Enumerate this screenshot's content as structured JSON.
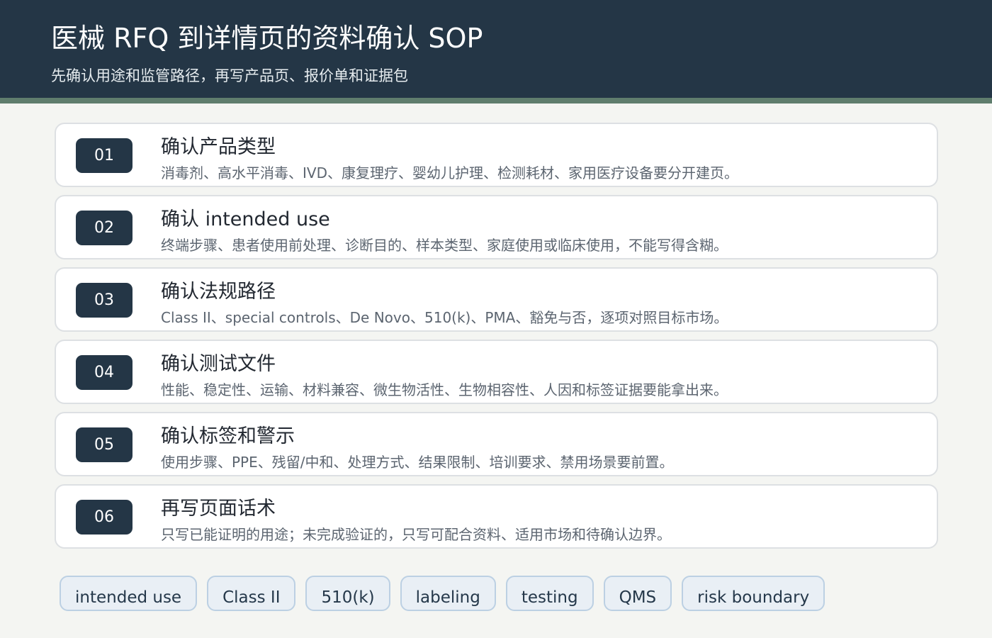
{
  "header": {
    "title": "医械 RFQ 到详情页的资料确认 SOP",
    "subtitle": "先确认用途和监管路径，再写产品页、报价单和证据包"
  },
  "steps": [
    {
      "number": "01",
      "title": "确认产品类型",
      "description": "消毒剂、高水平消毒、IVD、康复理疗、婴幼儿护理、检测耗材、家用医疗设备要分开建页。"
    },
    {
      "number": "02",
      "title": "确认 intended use",
      "description": "终端步骤、患者使用前处理、诊断目的、样本类型、家庭使用或临床使用，不能写得含糊。"
    },
    {
      "number": "03",
      "title": "确认法规路径",
      "description": "Class II、special controls、De Novo、510(k)、PMA、豁免与否，逐项对照目标市场。"
    },
    {
      "number": "04",
      "title": "确认测试文件",
      "description": "性能、稳定性、运输、材料兼容、微生物活性、生物相容性、人因和标签证据要能拿出来。"
    },
    {
      "number": "05",
      "title": "确认标签和警示",
      "description": "使用步骤、PPE、残留/中和、处理方式、结果限制、培训要求、禁用场景要前置。"
    },
    {
      "number": "06",
      "title": "再写页面话术",
      "description": "只写已能证明的用途；未完成验证的，只写可配合资料、适用市场和待确认边界。"
    }
  ],
  "tags": [
    "intended use",
    "Class II",
    "510(k)",
    "labeling",
    "testing",
    "QMS",
    "risk boundary"
  ],
  "colors": {
    "header_bg": "#243646",
    "accent_stripe": "#5f7d6d",
    "badge_bg": "#243646",
    "tag_bg": "#e9eff5",
    "tag_border": "#bcd0e3"
  }
}
